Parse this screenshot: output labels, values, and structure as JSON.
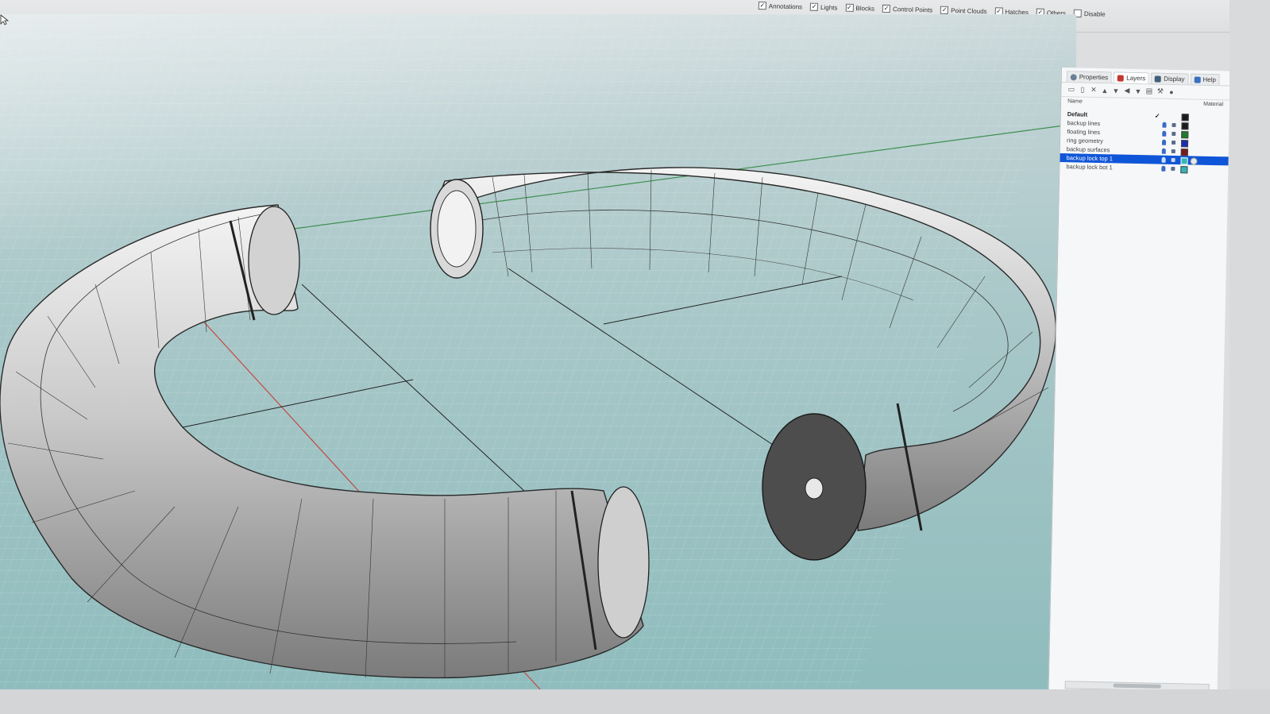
{
  "filters": [
    {
      "label": "Annotations",
      "checked": true
    },
    {
      "label": "Lights",
      "checked": true
    },
    {
      "label": "Blocks",
      "checked": true
    },
    {
      "label": "Control Points",
      "checked": true
    },
    {
      "label": "Point Clouds",
      "checked": true
    },
    {
      "label": "Hatches",
      "checked": true
    },
    {
      "label": "Others",
      "checked": true
    },
    {
      "label": "Disable",
      "checked": false
    }
  ],
  "panel": {
    "tabs": [
      {
        "label": "Properties",
        "icon": "properties-icon",
        "color": "#6b7f97"
      },
      {
        "label": "Layers",
        "icon": "layers-icon",
        "color": "#c2362b"
      },
      {
        "label": "Display",
        "icon": "display-icon",
        "color": "#41607a"
      },
      {
        "label": "Help",
        "icon": "help-icon",
        "color": "#3b6fc0"
      }
    ],
    "tools": [
      "new-layer-icon",
      "new-sublayer-icon",
      "delete-icon",
      "move-up-icon",
      "move-down-icon",
      "move-parent-icon",
      "filter-icon",
      "properties-icon",
      "tools-icon",
      "help-icon"
    ],
    "columns": {
      "name": "Name",
      "material": "Material"
    },
    "layers": [
      {
        "name": "Default",
        "current": true,
        "color": "#1a1a1a",
        "bold": true,
        "selected": false
      },
      {
        "name": "backup lines",
        "color": "#1a1a1a",
        "bold": false,
        "selected": false
      },
      {
        "name": "floating lines",
        "color": "#1f7a2f",
        "bold": false,
        "selected": false
      },
      {
        "name": "ring geometry",
        "color": "#1a2fb5",
        "bold": false,
        "selected": false
      },
      {
        "name": "backup surfaces",
        "color": "#7a1a1a",
        "bold": false,
        "selected": false
      },
      {
        "name": "backup lock top 1",
        "color": "#c0392b",
        "bold": false,
        "selected": true
      },
      {
        "name": "backup lock bot 1",
        "color": "#33b5b5",
        "bold": false,
        "selected": false
      }
    ]
  }
}
